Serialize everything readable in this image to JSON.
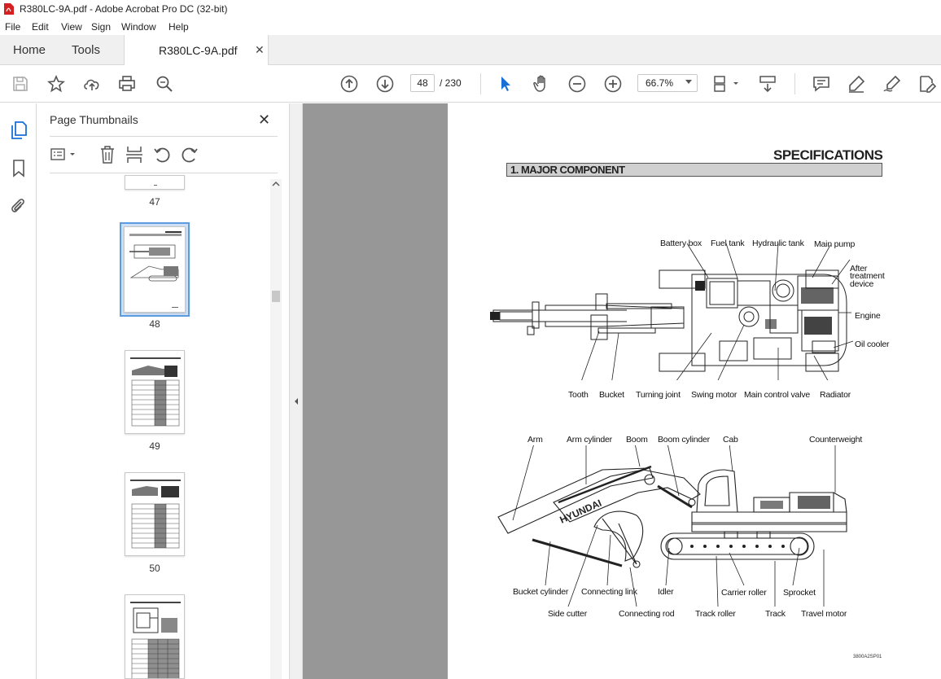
{
  "window": {
    "title": "R380LC-9A.pdf - Adobe Acrobat Pro DC (32-bit)"
  },
  "menu": [
    "File",
    "Edit",
    "View",
    "Sign",
    "Window",
    "Help"
  ],
  "tabs": {
    "home": "Home",
    "tools": "Tools",
    "document": "R380LC-9A.pdf"
  },
  "toolbar": {
    "current_page": "48",
    "total_pages": "/ 230",
    "zoom": "66.7%"
  },
  "thumbnail_panel": {
    "title": "Page Thumbnails",
    "pages": [
      "47",
      "48",
      "49",
      "50"
    ],
    "selected_page": "48"
  },
  "document": {
    "heading": "SPECIFICATIONS",
    "section": "1. MAJOR COMPONENT",
    "top_view_labels": {
      "battery_box": "Battery box",
      "fuel_tank": "Fuel tank",
      "hydraulic_tank": "Hydraulic tank",
      "main_pump": "Main pump",
      "after_treatment_1": "After",
      "after_treatment_2": "treatment",
      "after_treatment_3": "device",
      "engine": "Engine",
      "oil_cooler": "Oil cooler",
      "tooth": "Tooth",
      "bucket": "Bucket",
      "turning_joint": "Turning joint",
      "swing_motor": "Swing motor",
      "main_control_valve": "Main control valve",
      "radiator": "Radiator"
    },
    "side_view_labels": {
      "arm": "Arm",
      "arm_cylinder": "Arm cylinder",
      "boom": "Boom",
      "boom_cylinder": "Boom cylinder",
      "cab": "Cab",
      "counterweight": "Counterweight",
      "bucket_cylinder": "Bucket cylinder",
      "connecting_link": "Connecting link",
      "idler": "Idler",
      "carrier_roller": "Carrier roller",
      "sprocket": "Sprocket",
      "side_cutter": "Side cutter",
      "connecting_rod": "Connecting rod",
      "track_roller": "Track roller",
      "track": "Track",
      "travel_motor": "Travel motor"
    },
    "brand": "HYUNDAI",
    "figure_code": "3800A2SP01"
  },
  "colors": {
    "doc_background": "#979797",
    "accent_blue": "#1a6fd6",
    "pdf_red": "#d4201f"
  }
}
